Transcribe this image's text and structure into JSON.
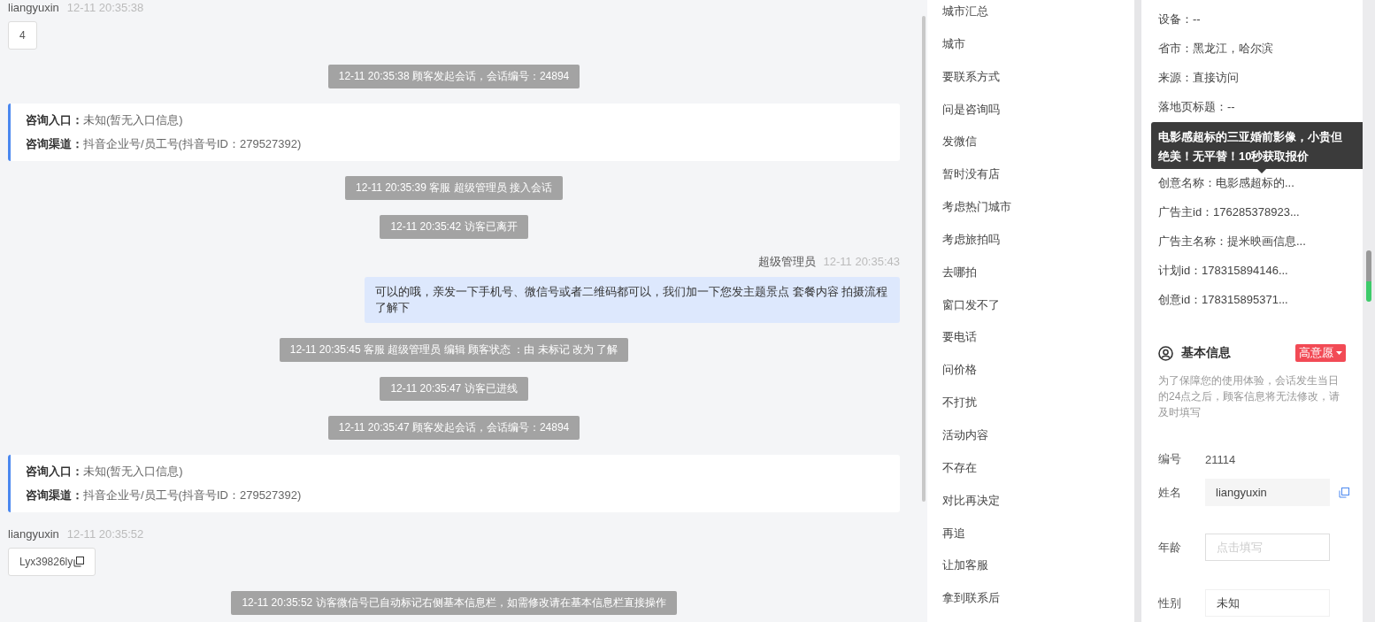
{
  "chat": {
    "messages": [
      {
        "kind": "visitor",
        "name": "liangyuxin",
        "time": "12-11 20:35:38",
        "text": "4",
        "copyable": false
      },
      {
        "kind": "system",
        "text": "12-11 20:35:38 顾客发起会话，会话编号：24894"
      },
      {
        "kind": "entry",
        "lines": [
          {
            "label": "咨询入口：",
            "value": "未知(暂无入口信息)"
          },
          {
            "label": "咨询渠道：",
            "value": "抖音企业号/员工号(抖音号ID：279527392)"
          }
        ]
      },
      {
        "kind": "system",
        "text": "12-11 20:35:39 客服 超级管理员 接入会话"
      },
      {
        "kind": "system",
        "text": "12-11 20:35:42 访客已离开"
      },
      {
        "kind": "agent",
        "name": "超级管理员",
        "time": "12-11 20:35:43",
        "text": "可以的哦，亲发一下手机号、微信号或者二维码都可以，我们加一下您发主题景点 套餐内容 拍摄流程了解下"
      },
      {
        "kind": "system",
        "text": "12-11 20:35:45 客服 超级管理员 编辑 顾客状态 ：由 未标记 改为 了解"
      },
      {
        "kind": "system",
        "text": "12-11 20:35:47 访客已进线"
      },
      {
        "kind": "system",
        "text": "12-11 20:35:47 顾客发起会话，会话编号：24894"
      },
      {
        "kind": "entry",
        "lines": [
          {
            "label": "咨询入口：",
            "value": "未知(暂无入口信息)"
          },
          {
            "label": "咨询渠道：",
            "value": "抖音企业号/员工号(抖音号ID：279527392)"
          }
        ]
      },
      {
        "kind": "visitor",
        "name": "liangyuxin",
        "time": "12-11 20:35:52",
        "text": "Lyx39826ly",
        "copyable": true
      },
      {
        "kind": "system",
        "text": "12-11 20:35:52 访客微信号已自动标记右侧基本信息栏，如需修改请在基本信息栏直接操作"
      }
    ]
  },
  "quick_replies": {
    "items": [
      "城市汇总",
      "城市",
      "要联系方式",
      "问是咨询吗",
      "发微信",
      "暂时没有店",
      "考虑热门城市",
      "考虑旅拍吗",
      "去哪拍",
      "窗口发不了",
      "要电话",
      "问价格",
      "不打扰",
      "活动内容",
      "不存在",
      "对比再决定",
      "再追",
      "让加客服",
      "拿到联系后"
    ]
  },
  "visitor_info": {
    "fields_before_tooltip": [
      "设备：--",
      "省市：黑龙江，哈尔滨",
      "来源：直接访问",
      "落地页标题：--"
    ],
    "tooltip": "电影感超标的三亚婚前影像，小贵但绝美！无平替！10秒获取报价",
    "fields_after_tooltip": [
      "创意名称：电影感超标的...",
      "广告主id：176285378923...",
      "广告主名称：提米映画信息...",
      "计划id：178315894146...",
      "创意id：178315895371..."
    ]
  },
  "basic_info": {
    "title": "基本信息",
    "intent_tag": "高意愿",
    "notice": "为了保障您的使用体验，会话发生当日的24点之后，顾客信息将无法修改，请及时填写",
    "fields": [
      {
        "kind": "text",
        "label": "编号",
        "value": "21114"
      },
      {
        "kind": "filled",
        "label": "姓名",
        "value": "liangyuxin",
        "copyable": true
      },
      {
        "kind": "input",
        "label": "年龄",
        "placeholder": "点击填写"
      },
      {
        "kind": "select",
        "label": "性别",
        "value": "未知"
      }
    ]
  }
}
